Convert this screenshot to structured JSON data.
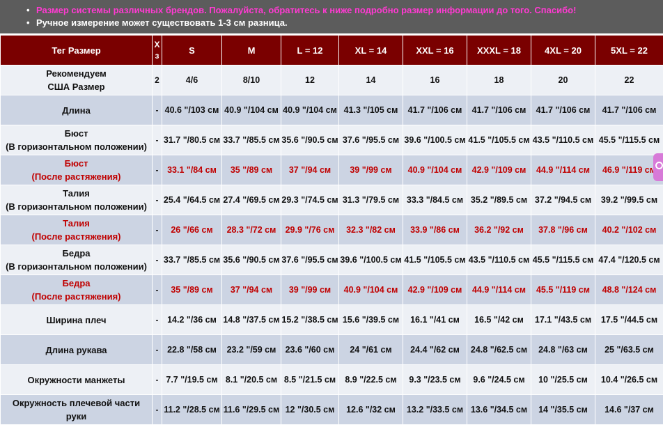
{
  "notes": [
    "Размер системы различных брендов. Пожалуйста, обратитесь к ниже подробно размер информации до того. Спасибо!",
    "Ручное измерение может существовать 1-3 см разница."
  ],
  "header": {
    "tag_label": "Тег Размер",
    "xs_label_1": "X",
    "xs_label_2": "з",
    "sizes": [
      "S",
      "M",
      "L = 12",
      "XL = 14",
      "XXL = 16",
      "XXXL = 18",
      "4XL = 20",
      "5XL = 22"
    ]
  },
  "rows": [
    {
      "label_1": "Рекомендуем",
      "label_2": "США Размер",
      "xs": "2",
      "values": [
        "4/6",
        "8/10",
        "12",
        "14",
        "16",
        "18",
        "20",
        "22"
      ]
    },
    {
      "label_1": "Длина",
      "label_2": "",
      "xs": "-",
      "values": [
        "40.6 \"/103 см",
        "40.9 \"/104 см",
        "40.9 \"/104 см",
        "41.3 \"/105 см",
        "41.7 \"/106 см",
        "41.7 \"/106 см",
        "41.7 \"/106 см",
        "41.7 \"/106 см"
      ]
    },
    {
      "label_1": "Бюст",
      "label_2": "(В горизонтальном положении)",
      "xs": "-",
      "values": [
        "31.7 \"/80.5 см",
        "33.7 \"/85.5 см",
        "35.6 \"/90.5 см",
        "37.6 \"/95.5 см",
        "39.6 \"/100.5 см",
        "41.5 \"/105.5 см",
        "43.5 \"/110.5 см",
        "45.5 \"/115.5 см"
      ]
    },
    {
      "label_1": "Бюст",
      "label_2": "(После растяжения)",
      "xs": "-",
      "values": [
        "33.1 \"/84 см",
        "35 \"/89 см",
        "37 \"/94 см",
        "39 \"/99 см",
        "40.9 \"/104 см",
        "42.9 \"/109 см",
        "44.9 \"/114 см",
        "46.9 \"/119 см"
      ]
    },
    {
      "label_1": "Талия",
      "label_2": "(В горизонтальном положении)",
      "xs": "-",
      "values": [
        "25.4 \"/64.5 см",
        "27.4 \"/69.5 см",
        "29.3 \"/74.5 см",
        "31.3 \"/79.5 см",
        "33.3 \"/84.5 см",
        "35.2 \"/89.5 см",
        "37.2 \"/94.5 см",
        "39.2 \"/99.5 см"
      ]
    },
    {
      "label_1": "Талия",
      "label_2": "(После растяжения)",
      "xs": "-",
      "values": [
        "26 \"/66 см",
        "28.3 \"/72 см",
        "29.9 \"/76 см",
        "32.3 \"/82 см",
        "33.9 \"/86 см",
        "36.2 \"/92 см",
        "37.8 \"/96 см",
        "40.2 \"/102 см"
      ]
    },
    {
      "label_1": "Бедра",
      "label_2": "(В горизонтальном положении)",
      "xs": "-",
      "values": [
        "33.7 \"/85.5 см",
        "35.6 \"/90.5 см",
        "37.6 \"/95.5 см",
        "39.6 \"/100.5 см",
        "41.5 \"/105.5 см",
        "43.5 \"/110.5 см",
        "45.5 \"/115.5 см",
        "47.4 \"/120.5 см"
      ]
    },
    {
      "label_1": "Бедра",
      "label_2": "(После растяжения)",
      "xs": "-",
      "values": [
        "35 \"/89 см",
        "37 \"/94 см",
        "39 \"/99 см",
        "40.9 \"/104 см",
        "42.9 \"/109 см",
        "44.9 \"/114 см",
        "45.5 \"/119 см",
        "48.8 \"/124 см"
      ]
    },
    {
      "label_1": "Ширина плеч",
      "label_2": "",
      "xs": "-",
      "values": [
        "14.2 \"/36 см",
        "14.8 \"/37.5 см",
        "15.2 \"/38.5 см",
        "15.6 \"/39.5 см",
        "16.1 \"/41 см",
        "16.5 \"/42 см",
        "17.1 \"/43.5 см",
        "17.5 \"/44.5 см"
      ]
    },
    {
      "label_1": "Длина рукава",
      "label_2": "",
      "xs": "-",
      "values": [
        "22.8 \"/58 см",
        "23.2 \"/59 см",
        "23.6 \"/60 см",
        "24 \"/61 см",
        "24.4 \"/62 см",
        "24.8 \"/62.5 см",
        "24.8 \"/63 см",
        "25 \"/63.5 см"
      ]
    },
    {
      "label_1": "Окружности манжеты",
      "label_2": "",
      "xs": "-",
      "values": [
        "7.7 \"/19.5 см",
        "8.1 \"/20.5 см",
        "8.5 \"/21.5 см",
        "8.9 \"/22.5 см",
        "9.3 \"/23.5 см",
        "9.6 \"/24.5 см",
        "10 \"/25.5 см",
        "10.4 \"/26.5 см"
      ]
    },
    {
      "label_1": "Окружность плечевой части",
      "label_2": "руки",
      "xs": "-",
      "values": [
        "11.2 \"/28.5 см",
        "11.6 \"/29.5 см",
        "12 \"/30.5 см",
        "12.6 \"/32 см",
        "13.2 \"/33.5 см",
        "13.6 \"/34.5 см",
        "14 \"/35.5 см",
        "14.6 \"/37 см"
      ]
    }
  ],
  "colors": {
    "header_bg": "#7a0000",
    "note_bg": "#5c5c5c",
    "note_highlight": "#ff3ad2",
    "stretch_text": "#c00000",
    "row_alt": "#ccd4e3",
    "row_plain": "#edf0f5"
  }
}
